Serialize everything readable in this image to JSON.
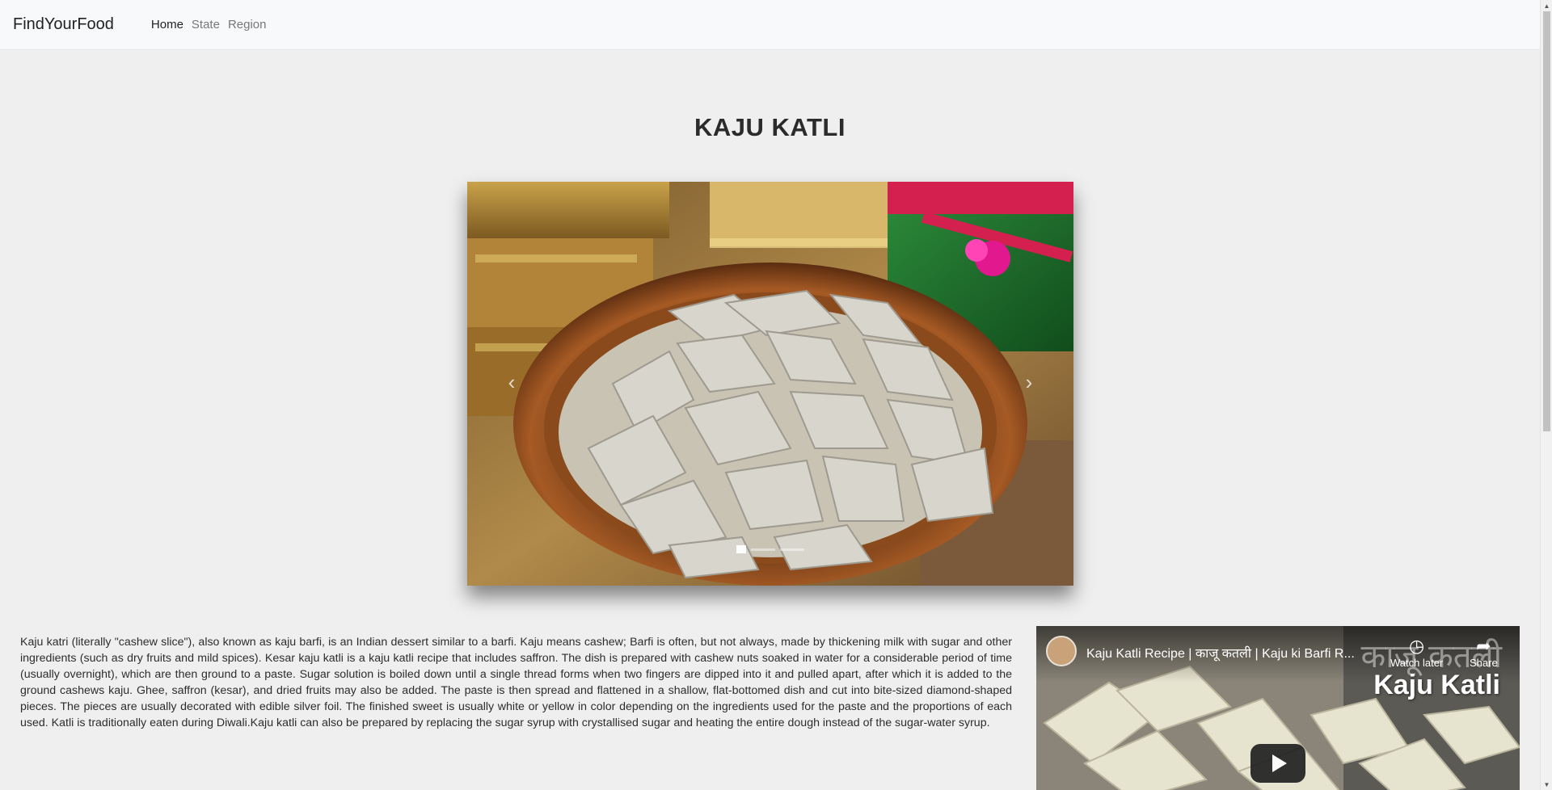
{
  "navbar": {
    "brand": "FindYourFood",
    "links": [
      {
        "label": "Home",
        "active": true
      },
      {
        "label": "State",
        "active": false
      },
      {
        "label": "Region",
        "active": false
      }
    ]
  },
  "page": {
    "title": "KAJU KATLI"
  },
  "carousel": {
    "prev_icon": "chevron-left-icon",
    "next_icon": "chevron-right-icon",
    "slide_count": 3,
    "active_slide": 1
  },
  "description": "Kaju katri (literally \"cashew slice\"), also known as kaju barfi, is an Indian dessert similar to a barfi. Kaju means cashew; Barfi is often, but not always, made by thickening milk with sugar and other ingredients (such as dry fruits and mild spices). Kesar kaju katli is a kaju katli recipe that includes saffron. The dish is prepared with cashew nuts soaked in water for a considerable period of time (usually overnight), which are then ground to a paste. Sugar solution is boiled down until a single thread forms when two fingers are dipped into it and pulled apart, after which it is added to the ground cashews kaju. Ghee, saffron (kesar), and dried fruits may also be added. The paste is then spread and flattened in a shallow, flat-bottomed dish and cut into bite-sized diamond-shaped pieces. The pieces are usually decorated with edible silver foil. The finished sweet is usually white or yellow in color depending on the ingredients used for the paste and the proportions of each used. Katli is traditionally eaten during Diwali.Kaju katli can also be prepared by replacing the sugar syrup with crystallised sugar and heating the entire dough instead of the sugar-water syrup.",
  "video": {
    "title": "Kaju Katli Recipe | काजू कतली | Kaju ki Barfi R...",
    "watch_later": "Watch later",
    "share": "Share",
    "overlay_hindi": "काजू कतली",
    "overlay_name": "Kaju Katli"
  },
  "colors": {
    "background": "#efefef",
    "navbar": "#f8f9fa"
  }
}
